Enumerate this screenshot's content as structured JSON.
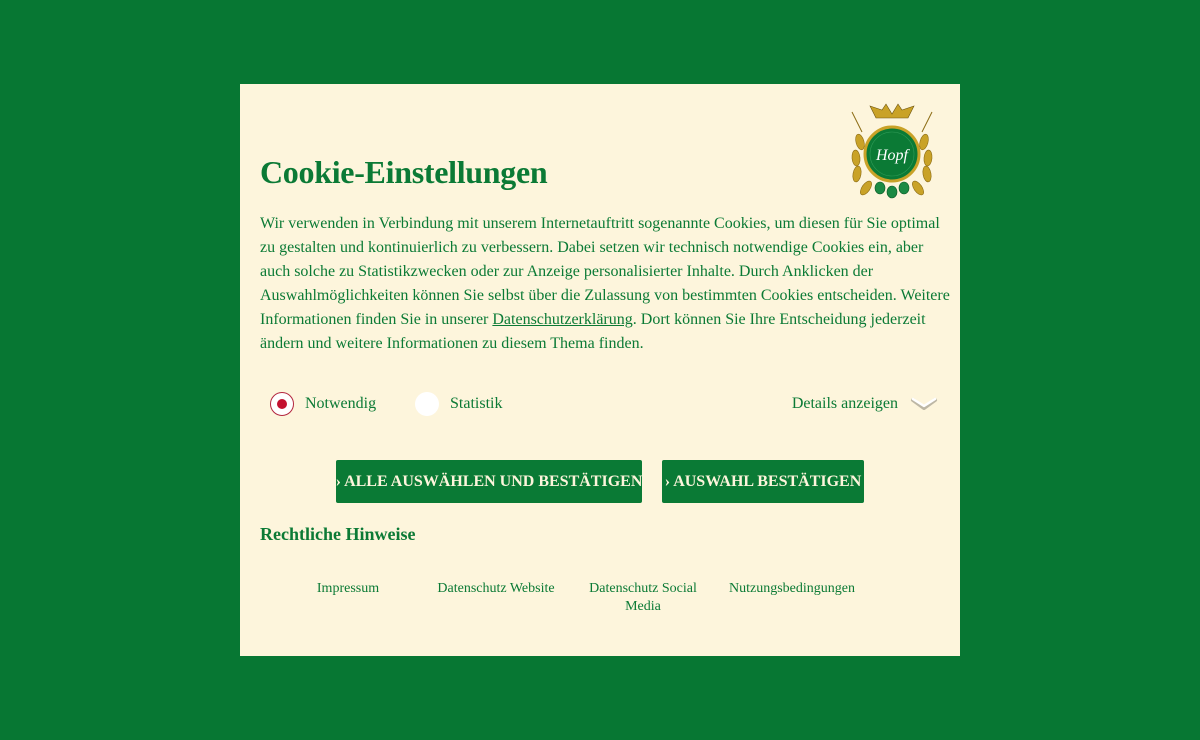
{
  "colors": {
    "page_background": "#077733",
    "modal_background": "#fdf5dc",
    "brand_green": "#0b7a35",
    "radio_selected": "#c3112f"
  },
  "logo": {
    "text": "Hopf",
    "icon": "hops-wreath-logo"
  },
  "title": "Cookie-Einstellungen",
  "intro": {
    "before_link": "Wir verwenden in Verbindung mit unserem Internetauftritt sogenannte Cookies, um diesen für Sie optimal zu gestalten und kontinuierlich zu verbessern. Dabei setzen wir technisch notwendige Cookies ein, aber auch solche zu Statistikzwecken oder zur Anzeige personalisierter Inhalte. Durch Anklicken der Auswahlmöglichkeiten können Sie selbst über die Zulassung von bestimmten Cookies entscheiden. Weitere Informationen finden Sie in unserer ",
    "link": "Datenschutzerklärung",
    "after_link": ". Dort können Sie Ihre Entscheidung jederzeit ändern und weitere Informationen zu diesem Thema finden."
  },
  "options": [
    {
      "label": "Notwendig",
      "checked": true
    },
    {
      "label": "Statistik",
      "checked": false
    }
  ],
  "details": {
    "label": "Details anzeigen",
    "icon": "chevron-down-icon"
  },
  "buttons": {
    "accept_all": "› ALLE AUSWÄHLEN UND BESTÄTIGEN",
    "accept_selection": "› AUSWAHL BESTÄTIGEN"
  },
  "legal": {
    "title": "Rechtliche Hinweise",
    "links": [
      "Impressum",
      "Datenschutz Website",
      "Datenschutz Social Media",
      "Nutzungsbedingungen"
    ]
  }
}
